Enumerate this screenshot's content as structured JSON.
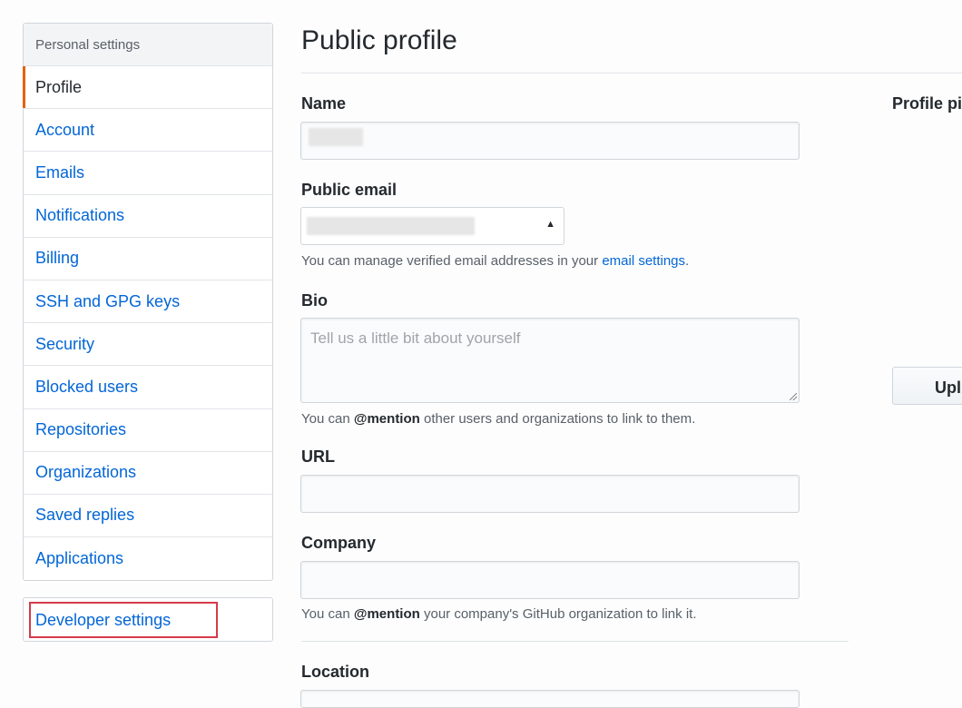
{
  "sidebar": {
    "header": "Personal settings",
    "items": [
      {
        "label": "Profile",
        "selected": true
      },
      {
        "label": "Account"
      },
      {
        "label": "Emails"
      },
      {
        "label": "Notifications"
      },
      {
        "label": "Billing"
      },
      {
        "label": "SSH and GPG keys"
      },
      {
        "label": "Security"
      },
      {
        "label": "Blocked users"
      },
      {
        "label": "Repositories"
      },
      {
        "label": "Organizations"
      },
      {
        "label": "Saved replies"
      },
      {
        "label": "Applications"
      }
    ],
    "developer_settings": "Developer settings"
  },
  "main": {
    "title": "Public profile",
    "name": {
      "label": "Name"
    },
    "public_email": {
      "label": "Public email",
      "note_prefix": "You can manage verified email addresses in your ",
      "note_link": "email settings",
      "note_suffix": "."
    },
    "bio": {
      "label": "Bio",
      "placeholder": "Tell us a little bit about yourself",
      "note_prefix": "You can ",
      "note_bold": "@mention",
      "note_suffix": " other users and organizations to link to them."
    },
    "url": {
      "label": "URL"
    },
    "company": {
      "label": "Company",
      "note_prefix": "You can ",
      "note_bold": "@mention",
      "note_suffix": " your company's GitHub organization to link it."
    },
    "location": {
      "label": "Location"
    }
  },
  "right": {
    "profile_picture_label": "Profile pic",
    "upload_button": "Upl"
  },
  "colors": {
    "link": "#0366d6",
    "selected_indicator": "#e36209",
    "highlight_box": "#d73a49"
  }
}
